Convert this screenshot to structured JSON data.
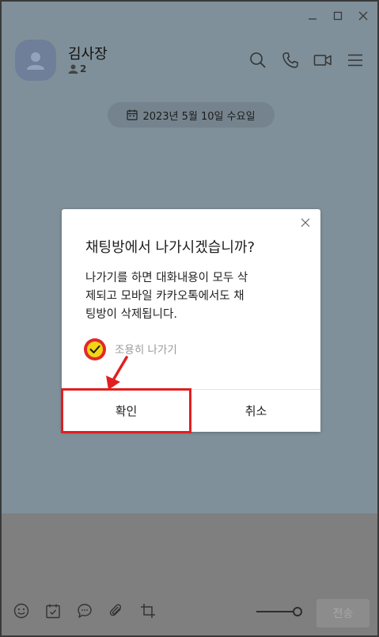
{
  "chat": {
    "title": "김사장",
    "member_count": "2"
  },
  "date_badge": {
    "text": "2023년 5월 10일 수요일"
  },
  "dialog": {
    "title": "채팅방에서 나가시겠습니까?",
    "message": "나가기를 하면 대화내용이 모두 삭\n제되고 모바일 카카오톡에서도 채\n팅방이 삭제됩니다.",
    "quiet_leave_label": "조용히 나가기",
    "quiet_leave_checked": true,
    "confirm_label": "확인",
    "cancel_label": "취소"
  },
  "composer": {
    "send_label": "전송"
  },
  "icons": {
    "window": [
      "minimize-icon",
      "maximize-icon",
      "close-icon"
    ],
    "header": [
      "search-icon",
      "phone-icon",
      "video-icon",
      "menu-icon"
    ],
    "toolbar": [
      "emoji-icon",
      "calendar-icon",
      "chat-bubble-icon",
      "attachment-icon",
      "crop-icon"
    ]
  },
  "colors": {
    "highlight": "#e02020",
    "check_fill": "#f2d514",
    "chat_background": "#7f909a"
  }
}
